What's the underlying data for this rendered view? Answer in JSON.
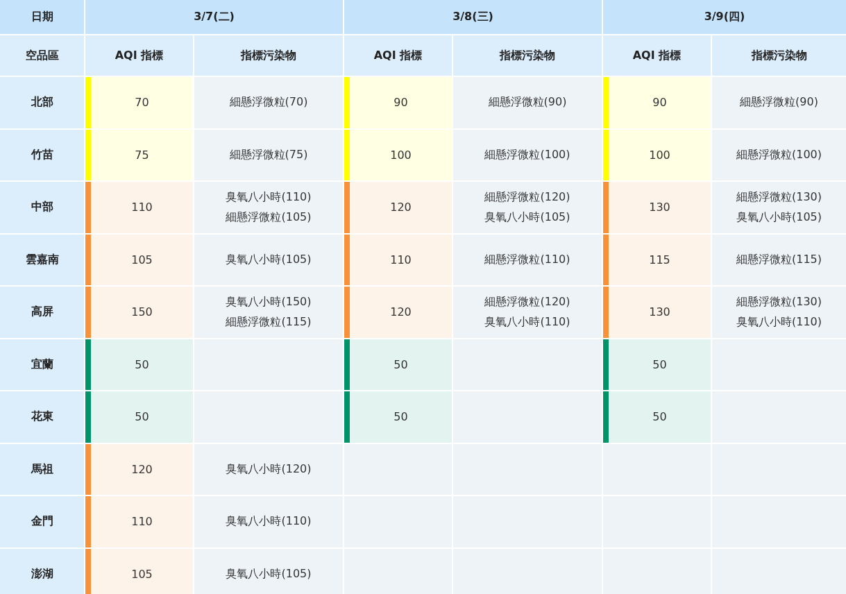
{
  "header": {
    "date_label": "日期",
    "region_label": "空品區",
    "days": [
      {
        "date": "3/7(二)",
        "aqi_label": "AQI 指標",
        "pollutant_label": "指標污染物"
      },
      {
        "date": "3/8(三)",
        "aqi_label": "AQI 指標",
        "pollutant_label": "指標污染物"
      },
      {
        "date": "3/9(四)",
        "aqi_label": "AQI 指標",
        "pollutant_label": "指標污染物"
      }
    ]
  },
  "regions": [
    {
      "name": "北部",
      "days": [
        {
          "aqi": "70",
          "color": "#ffff00",
          "pollutants": [
            "細懸浮微粒(70)"
          ]
        },
        {
          "aqi": "90",
          "color": "#ffff00",
          "pollutants": [
            "細懸浮微粒(90)"
          ]
        },
        {
          "aqi": "90",
          "color": "#ffff00",
          "pollutants": [
            "細懸浮微粒(90)"
          ]
        }
      ]
    },
    {
      "name": "竹苗",
      "days": [
        {
          "aqi": "75",
          "color": "#ffff00",
          "pollutants": [
            "細懸浮微粒(75)"
          ]
        },
        {
          "aqi": "100",
          "color": "#ffff00",
          "pollutants": [
            "細懸浮微粒(100)"
          ]
        },
        {
          "aqi": "100",
          "color": "#ffff00",
          "pollutants": [
            "細懸浮微粒(100)"
          ]
        }
      ]
    },
    {
      "name": "中部",
      "days": [
        {
          "aqi": "110",
          "color": "#f7923a",
          "pollutants": [
            "臭氧八小時(110)",
            "細懸浮微粒(105)"
          ]
        },
        {
          "aqi": "120",
          "color": "#f7923a",
          "pollutants": [
            "細懸浮微粒(120)",
            "臭氧八小時(105)"
          ]
        },
        {
          "aqi": "130",
          "color": "#f7923a",
          "pollutants": [
            "細懸浮微粒(130)",
            "臭氧八小時(105)"
          ]
        }
      ]
    },
    {
      "name": "雲嘉南",
      "days": [
        {
          "aqi": "105",
          "color": "#f7923a",
          "pollutants": [
            "臭氧八小時(105)"
          ]
        },
        {
          "aqi": "110",
          "color": "#f7923a",
          "pollutants": [
            "細懸浮微粒(110)"
          ]
        },
        {
          "aqi": "115",
          "color": "#f7923a",
          "pollutants": [
            "細懸浮微粒(115)"
          ]
        }
      ]
    },
    {
      "name": "高屏",
      "days": [
        {
          "aqi": "150",
          "color": "#f7923a",
          "pollutants": [
            "臭氧八小時(150)",
            "細懸浮微粒(115)"
          ]
        },
        {
          "aqi": "120",
          "color": "#f7923a",
          "pollutants": [
            "細懸浮微粒(120)",
            "臭氧八小時(110)"
          ]
        },
        {
          "aqi": "130",
          "color": "#f7923a",
          "pollutants": [
            "細懸浮微粒(130)",
            "臭氧八小時(110)"
          ]
        }
      ]
    },
    {
      "name": "宜蘭",
      "days": [
        {
          "aqi": "50",
          "color": "#00936a"
        },
        {
          "aqi": "50",
          "color": "#00936a"
        },
        {
          "aqi": "50",
          "color": "#00936a"
        }
      ]
    },
    {
      "name": "花東",
      "days": [
        {
          "aqi": "50",
          "color": "#00936a"
        },
        {
          "aqi": "50",
          "color": "#00936a"
        },
        {
          "aqi": "50",
          "color": "#00936a"
        }
      ]
    },
    {
      "name": "馬祖",
      "days": [
        {
          "aqi": "120",
          "color": "#f7923a",
          "pollutants": [
            "臭氧八小時(120)"
          ]
        }
      ]
    },
    {
      "name": "金門",
      "days": [
        {
          "aqi": "110",
          "color": "#f7923a",
          "pollutants": [
            "臭氧八小時(110)"
          ]
        }
      ]
    },
    {
      "name": "澎湖",
      "days": [
        {
          "aqi": "105",
          "color": "#f7923a",
          "pollutants": [
            "臭氧八小時(105)"
          ]
        }
      ]
    }
  ]
}
